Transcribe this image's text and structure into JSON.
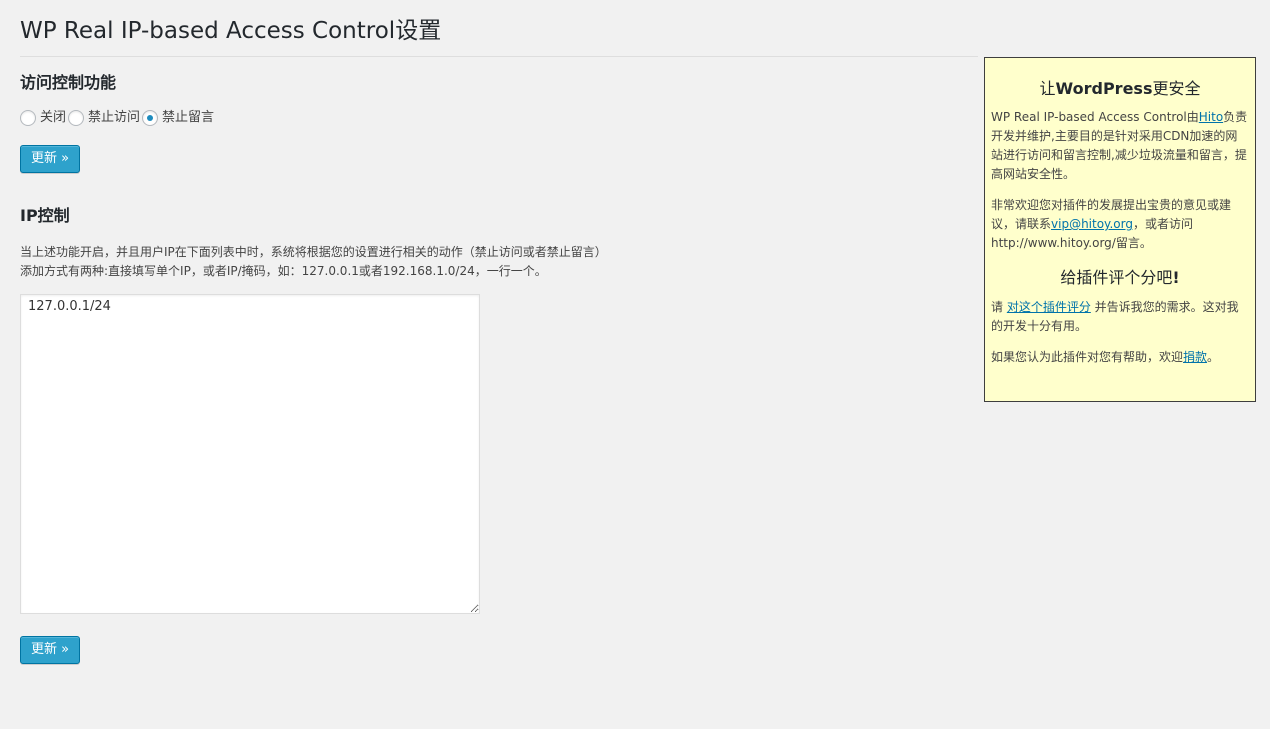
{
  "page": {
    "title": "WP Real IP-based Access Control设置"
  },
  "access_section": {
    "heading": "访问控制功能",
    "options": [
      {
        "label": "关闭",
        "checked": false
      },
      {
        "label": "禁止访问",
        "checked": false
      },
      {
        "label": "禁止留言",
        "checked": true
      }
    ],
    "update_label": "更新 »"
  },
  "ip_section": {
    "heading": "IP控制",
    "description_line1": "当上述功能开启，并且用户IP在下面列表中时，系统将根据您的设置进行相关的动作（禁止访问或者禁止留言）",
    "description_line2": "添加方式有两种:直接填写单个IP，或者IP/掩码，如：127.0.0.1或者192.168.1.0/24，一行一个。",
    "ip_list_value": "127.0.0.1/24",
    "update_label": "更新 »"
  },
  "sidebar": {
    "heading_prefix": "让",
    "heading_brand": "WordPress",
    "heading_suffix": "更安全",
    "para1_a": "WP Real IP-based Access Control由",
    "para1_link": "Hito",
    "para1_b": "负责开发并维护,主要目的是针对采用CDN加速的网站进行访问和留言控制,减少垃圾流量和留言，提高网站安全性。",
    "para2_a": "非常欢迎您对插件的发展提出宝贵的意见或建议，请联系",
    "para2_link": "vip@hitoy.org",
    "para2_b": "，或者访问http://www.hitoy.org/留言。",
    "heading2_text": "给插件评个分吧",
    "heading2_mark": "!",
    "para3_a": "请 ",
    "para3_link": "对这个插件评分",
    "para3_b": " 并告诉我您的需求。这对我的开发十分有用。",
    "para4_a": "如果您认为此插件对您有帮助，欢迎",
    "para4_link": "捐款",
    "para4_b": "。"
  },
  "colors": {
    "background": "#f1f1f1",
    "primary_button": "#2ea2cc",
    "sidebar_background": "#ffffcc",
    "link": "#0073aa"
  }
}
